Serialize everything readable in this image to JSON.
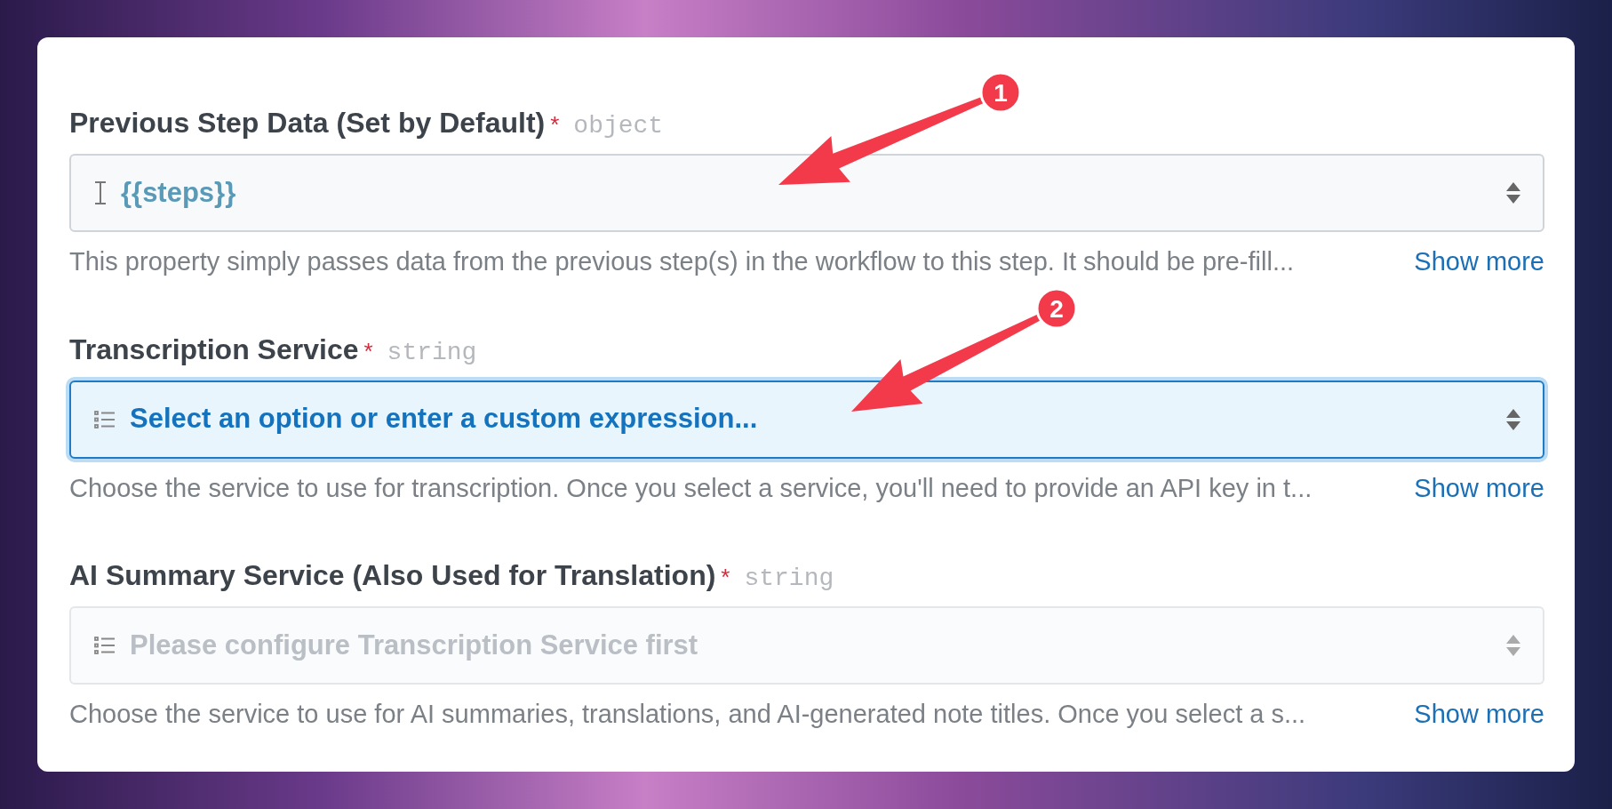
{
  "fields": [
    {
      "label": "Previous Step Data (Set by Default)",
      "required_mark": "*",
      "type": "object",
      "kind": "text",
      "value": "{{steps}}",
      "focused": false,
      "disabled": false,
      "help": "This property simply passes data from the previous step(s) in the workflow to this step. It should be pre-fill...",
      "link": "Show more"
    },
    {
      "label": "Transcription Service",
      "required_mark": "*",
      "type": "string",
      "kind": "select",
      "placeholder": "Select an option or enter a custom expression...",
      "focused": true,
      "disabled": false,
      "help": "Choose the service to use for transcription. Once you select a service, you'll need to provide an API key in t...",
      "link": "Show more"
    },
    {
      "label": "AI Summary Service (Also Used for Translation)",
      "required_mark": "*",
      "type": "string",
      "kind": "select",
      "placeholder": "Please configure Transcription Service first",
      "focused": false,
      "disabled": true,
      "help": "Choose the service to use for AI summaries, translations, and AI-generated note titles. Once you select a s...",
      "link": "Show more"
    }
  ],
  "annotations": [
    {
      "number": "1"
    },
    {
      "number": "2"
    }
  ]
}
